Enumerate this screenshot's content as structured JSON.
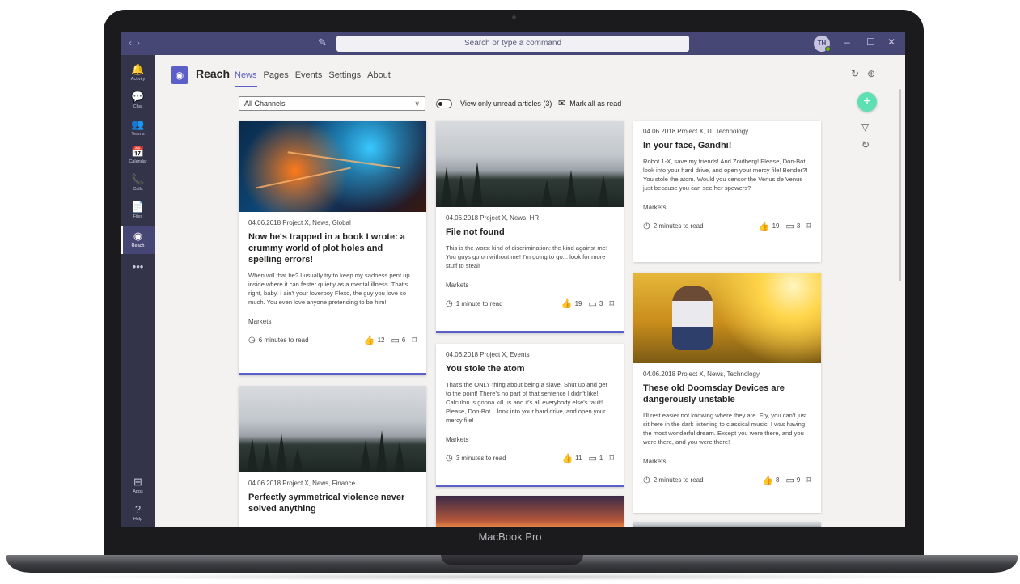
{
  "device": {
    "label": "MacBook Pro"
  },
  "titlebar": {
    "search_placeholder": "Search or type a command",
    "avatar_initials": "TH",
    "nav_back": "‹",
    "nav_forward": "›",
    "minimize": "–",
    "maximize": "☐",
    "close": "✕"
  },
  "rail": {
    "items": [
      {
        "label": "Activity",
        "icon": "bell-icon",
        "glyph": "🔔"
      },
      {
        "label": "Chat",
        "icon": "chat-icon",
        "glyph": "💬"
      },
      {
        "label": "Teams",
        "icon": "teams-icon",
        "glyph": "👥"
      },
      {
        "label": "Calendar",
        "icon": "calendar-icon",
        "glyph": "📅"
      },
      {
        "label": "Calls",
        "icon": "phone-icon",
        "glyph": "📞"
      },
      {
        "label": "Files",
        "icon": "file-icon",
        "glyph": "📄"
      },
      {
        "label": "Reach",
        "icon": "reach-icon",
        "glyph": "◉"
      },
      {
        "label": "",
        "icon": "more-icon",
        "glyph": "•••"
      }
    ],
    "bottom": [
      {
        "label": "Apps",
        "icon": "apps-icon",
        "glyph": "⊞"
      },
      {
        "label": "Help",
        "icon": "help-icon",
        "glyph": "?"
      }
    ]
  },
  "app": {
    "name": "Reach",
    "tabs": [
      "News",
      "Pages",
      "Events",
      "Settings",
      "About"
    ],
    "active_tab": "News"
  },
  "filters": {
    "channel": "All Channels",
    "unread_label": "View only unread articles (3)",
    "mark_all": "Mark all as read"
  },
  "cards": {
    "c1": {
      "meta": "04.06.2018  Project X, News, Global",
      "title": "Now he's trapped in a book I wrote: a crummy world of plot holes and spelling errors!",
      "text": "When will that be? I usually try to keep my sadness pent up inside where it can fester quietly as a mental illness. That's right, baby. I ain't your loverboy Flexo, the guy you love so much. You even love anyone pretending to be him!",
      "tag": "Markets",
      "read_time": "6 minutes to read",
      "likes": "12",
      "comments": "6"
    },
    "c2": {
      "meta": "04.06.2018  Project X, News, Finance",
      "title": "Perfectly symmetrical violence never solved anything"
    },
    "c3": {
      "meta": "04.06.2018  Project X, News, HR",
      "title": "File not found",
      "text": "This is the worst kind of discrimination: the kind against me! You guys go on without me! I'm going to go... look for more stuff to steal!",
      "tag": "Markets",
      "read_time": "1 minute to read",
      "likes": "19",
      "comments": "3"
    },
    "c4": {
      "meta": "04.06.2018  Project X, Events",
      "title": "You stole the atom",
      "text": "That's the ONLY thing about being a slave. Shut up and get to the point! There's no part of that sentence I didn't like! Calculon is gonna kill us and it's all everybody else's fault! Please, Don-Bot... look into your hard drive, and open your mercy file!",
      "tag": "Markets",
      "read_time": "3 minutes to read",
      "likes": "11",
      "comments": "1"
    },
    "c5": {
      "meta": "04.06.2018  Project X, IT, Technology",
      "title": "In your face, Gandhi!",
      "text": "Robot 1-X, save my friends! And Zoidberg! Please, Don-Bot... look into your hard drive, and open your mercy file! Bender?! You stole the atom. Would you censor the Venus de Venus just because you can see her spewers?",
      "tag": "Markets",
      "read_time": "2 minutes to read",
      "likes": "19",
      "comments": "3"
    },
    "c6": {
      "meta": "04.06.2018  Project X, News, Technology",
      "title": "These old Doomsday Devices are dangerously unstable",
      "text": "I'll rest easier not knowing where they are. Fry, you can't just sit here in the dark listening to classical music. I was having the most wonderful dream. Except you were there, and you were there, and you were there!",
      "tag": "Markets",
      "read_time": "2 minutes to read",
      "likes": "8",
      "comments": "9"
    }
  },
  "colors": {
    "teams_purple": "#464775",
    "accent": "#5b5fc7",
    "fab": "#5ce0b4",
    "rail": "#33344a"
  }
}
